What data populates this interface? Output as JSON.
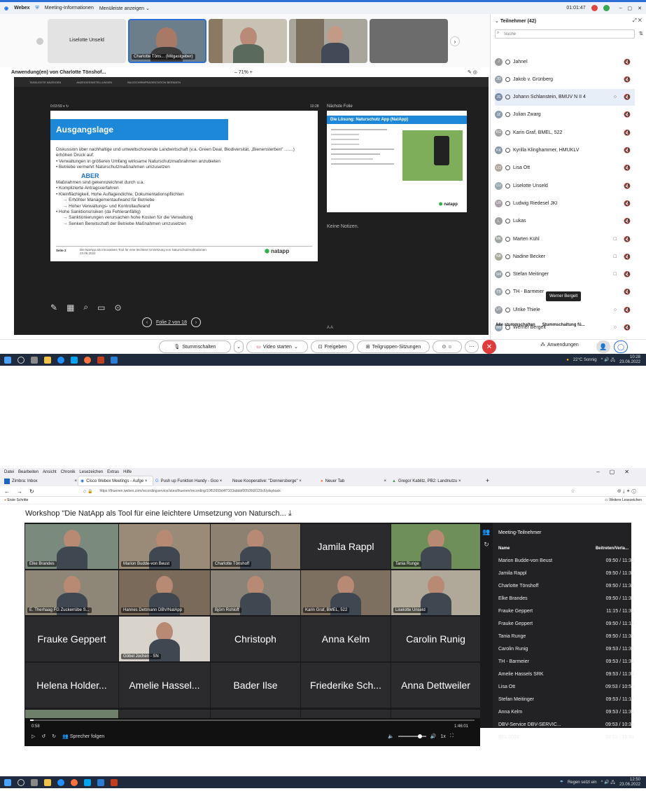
{
  "webex": {
    "app_title": "Webex",
    "meeting_info": "Meeting-Informationen",
    "menu_bar": "Menüleiste anzeigen",
    "timer": "01:01:47",
    "self_name": "Liselotte Unseld",
    "host_tile": "Charlotte Töns... (Mitgastgeber)",
    "app_share": "Anwendung(en) von Charlotte Tönshof...",
    "zoom": "71%",
    "presenter_bar": [
      "TASKLEISTE ANZEIGEN",
      "ANZEIGEEINSTELLUNGEN",
      "BILDSCHIRMPRÄSENTATION BEENDEN"
    ],
    "slide_time": "0:03:59",
    "clock": "10:28",
    "next_slide_label": "Nächste Folie",
    "notes": "Keine Notizen.",
    "slide": {
      "title": "Ausgangslage",
      "intro": "Diskussion über nachhaltige und umweltschonende Landwirtschaft (v.a. Green Deal, Biodiversität, „Bienensterben“ ……) erhöhen Druck auf:",
      "b1": "Verwaltungen in größeren Umfang wirksame Naturschutzmaßnahmen anzubieten",
      "b2": "Betriebe vermehrt Naturschutzmaßnahmen umzusetzen",
      "aber": "ABER",
      "sub": "Maßnahmen sind gekennzeichnet durch u.a.",
      "b3": "Komplizierte Antragsverfahren",
      "b4": "Kleinflächigkeit, Hohe Auflagendichte, Dokumentationspflichten",
      "a1": "→ Erhöhter Managementaufwand für Betriebe",
      "a2": "→ Hoher Verwaltungs- und Kontrollaufwand",
      "b5": "Hohe Sanktionsrisiken (da Fehleranfällig)",
      "a3": "→ Sanktionierungen verursachen hohe Kosten für die Verwaltung",
      "a4": "→ Senken Bereitschaft der Betriebe Maßnahmen umzusetzen",
      "footer_page": "Seite 2",
      "footer_text": "Die NatApp als innovatives Tool für eine leichtere Umsetzung von Naturschutzmaßnahmen",
      "footer_date": "23.06.2022",
      "logo": "natapp"
    },
    "next_slide_title": "Die Lösung: Naturschutz App (NatApp)",
    "slide_counter": "Folie 2 von 18",
    "panel_title": "Teilnehmer (42)",
    "search_placeholder": "Suche",
    "participants": [
      {
        "ini": "J",
        "name": "Jahnel",
        "cam": ""
      },
      {
        "ini": "JG",
        "name": "Jakob v. Grünberg",
        "cam": ""
      },
      {
        "ini": "JS",
        "name": "Johann Schlanstein, BMUV N II 4",
        "cam": "○"
      },
      {
        "ini": "JZ",
        "name": "Julian Zwarg",
        "cam": ""
      },
      {
        "ini": "KG",
        "name": "Karin Graf, BMEL, 522",
        "cam": ""
      },
      {
        "ini": "KK",
        "name": "Kyrilla Klinghammer, HMUKLV",
        "cam": ""
      },
      {
        "ini": "LO",
        "name": "Lisa Ott",
        "cam": ""
      },
      {
        "ini": "LU",
        "name": "Liselotte Unseld",
        "cam": ""
      },
      {
        "ini": "LR",
        "name": "Ludwig Riedesel JKI",
        "cam": ""
      },
      {
        "ini": "L",
        "name": "Lukas",
        "cam": ""
      },
      {
        "ini": "MK",
        "name": "Marten Kühl",
        "cam": "□"
      },
      {
        "ini": "NB",
        "name": "Nadine Becker",
        "cam": "□"
      },
      {
        "ini": "SM",
        "name": "Stefan Meitinger",
        "cam": "□"
      },
      {
        "ini": "TB",
        "name": "TH - Barmeier",
        "cam": ""
      },
      {
        "ini": "UT",
        "name": "Ulrike Thiele",
        "cam": "○"
      },
      {
        "ini": "WB",
        "name": "Werner Bergelt",
        "cam": "○"
      }
    ],
    "tooltip": "Werner Bergelt",
    "mute_all": "Alle stummschalten",
    "mute_entry": "Stummschaltung fü...",
    "ctrl_mute": "Stummschalten",
    "ctrl_video": "Video starten",
    "ctrl_share": "Freigeben",
    "ctrl_breakout": "Teilgruppen-Sitzungen",
    "ctrl_apps": "Anwendungen",
    "weather1": "22°C Sonnig",
    "time1": "10:28",
    "date1": "23.06.2022"
  },
  "firefox": {
    "menus": [
      "Datei",
      "Bearbeiten",
      "Ansicht",
      "Chronik",
      "Lesezeichen",
      "Extras",
      "Hilfe"
    ],
    "tabs": [
      "Zimbra: Inbox",
      "Cisco Webex Meetings - Aufge ×",
      "Push up Funktion Handy - Goo ×",
      "Neue Kooperative: \"Donnersberge\" ×",
      "Neuer Tab",
      "Gregor Kablitz, PB2: Landnutzu ×"
    ],
    "url": "https://thuenen.webex.com/recordingservice/sites/thuenen/recording/10f52659d4f7103abbbf0050568120c6/playback",
    "bookmark": "Erste Schritte",
    "other_bookmarks": "Weitere Lesezeichen",
    "page_title": "Workshop \"Die NatApp als Tool für eine leichtere Umsetzung von Natursch...",
    "grid": [
      {
        "name": "Elke Brandes",
        "big": ""
      },
      {
        "name": "Marion Budde-von Beust",
        "big": ""
      },
      {
        "name": "Charlotte Tönshoff",
        "big": ""
      },
      {
        "name": "",
        "big": "Jamila Rappl"
      },
      {
        "name": "Tania Runge",
        "big": ""
      },
      {
        "name": "E. Therhaag FG Zuckerrübe S...",
        "big": ""
      },
      {
        "name": "Hannes Dettmann DBV/NatApp",
        "big": ""
      },
      {
        "name": "Björn Rohloff",
        "big": ""
      },
      {
        "name": "Karin Graf, BMEL, 522",
        "big": ""
      },
      {
        "name": "Liselotte Unseld",
        "big": ""
      },
      {
        "name": "",
        "big": "Frauke Geppert"
      },
      {
        "name": "Göbel Jochen - SN",
        "big": ""
      },
      {
        "name": "",
        "big": "Christoph"
      },
      {
        "name": "",
        "big": "Anna Kelm"
      },
      {
        "name": "",
        "big": "Carolin Runig"
      },
      {
        "name": "",
        "big": "Helena Holder..."
      },
      {
        "name": "",
        "big": "Amelie Hassel..."
      },
      {
        "name": "",
        "big": "Bader Ilse"
      },
      {
        "name": "",
        "big": "Friederike Sch..."
      },
      {
        "name": "",
        "big": "Anna Dettweiler"
      }
    ],
    "panel_title": "Meeting-Teilnehmer",
    "col_name": "Name",
    "col_time": "Beitreten/Verla...",
    "attendees": [
      {
        "n": "Marion Budde-von Beust",
        "t": "09:50 / 11:36"
      },
      {
        "n": "Jamila Rappl",
        "t": "09:50 / 11:36"
      },
      {
        "n": "Charlotte Tönshoff",
        "t": "09:50 / 11:36"
      },
      {
        "n": "Elke Brandes",
        "t": "09:50 / 11:36"
      },
      {
        "n": "Frauke Geppert",
        "t": "11:15 / 11:34"
      },
      {
        "n": "Frauke Geppert",
        "t": "09:50 / 11:14"
      },
      {
        "n": "Tania Runge",
        "t": "09:50 / 11:36"
      },
      {
        "n": "Carolin Runig",
        "t": "09:53 / 11:34"
      },
      {
        "n": "TH - Barmeier",
        "t": "09:53 / 11:34"
      },
      {
        "n": "Amelie Hassels SRK",
        "t": "09:53 / 11:34"
      },
      {
        "n": "Lisa Ott",
        "t": "09:53 / 10:50"
      },
      {
        "n": "Stefan Meitinger",
        "t": "09:53 / 11:17"
      },
      {
        "n": "Anna Kelm",
        "t": "09:53 / 11:34"
      },
      {
        "n": "DBV-Service DBV-SERVIC...",
        "t": "09:53 / 10:36"
      },
      {
        "n": "BKLS003",
        "t": "09:53 / 10:53"
      }
    ],
    "pos": "0:58",
    "dur": "1:46:01",
    "speed": "1x",
    "follow": "Sprecher folgen",
    "weather2": "Regen setzt ein",
    "time2": "12:50",
    "date2": "23.06.2022"
  }
}
